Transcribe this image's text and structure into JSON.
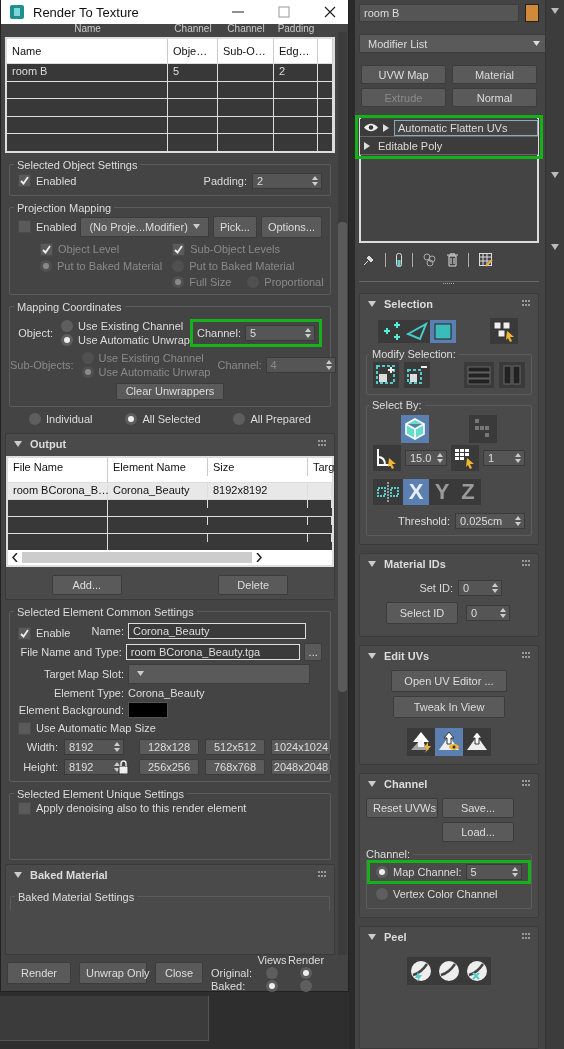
{
  "dialog": {
    "title": "Render To Texture",
    "objects": {
      "header_overflow": [
        "Name",
        "Channel",
        "Channel",
        "Padding"
      ],
      "columns": [
        "Name",
        "Obje…",
        "Sub-O…",
        "Edg…"
      ],
      "rows": [
        {
          "column_1": "room B",
          "column_2": "5",
          "column_4": "2"
        }
      ]
    },
    "selected_object_settings": {
      "title": "Selected Object Settings",
      "enabled": {
        "label": "Enabled",
        "checked": true
      },
      "padding": {
        "label": "Padding:",
        "value": "2"
      }
    },
    "projection_mapping": {
      "title": "Projection Mapping",
      "enabled": {
        "label": "Enabled",
        "checked": false
      },
      "modifier": "(No Proje...Modifier)",
      "buttons": [
        "Pick...",
        "Options..."
      ],
      "object_level": {
        "checkbox": {
          "label": "Object Level",
          "checked": true,
          "disabled": true
        },
        "radio": {
          "label": "Put to Baked Material",
          "selected": true,
          "disabled": true
        }
      },
      "sub_object_levels": {
        "checkbox": {
          "label": "Sub-Object Levels",
          "checked": true,
          "disabled": true
        },
        "radio": {
          "label": "Put to Baked Material",
          "selected": false,
          "disabled": true
        },
        "size_options": [
          {
            "label": "Full Size",
            "selected": true,
            "disabled": true
          },
          {
            "label": "Proportional",
            "selected": false,
            "disabled": true
          }
        ]
      }
    },
    "mapping_coordinates": {
      "title": "Mapping Coordinates",
      "object": {
        "label": "Object:",
        "disabled": false,
        "options": [
          {
            "label": "Use Existing Channel",
            "selected": false
          },
          {
            "label": "Use Automatic Unwrap",
            "selected": true
          }
        ],
        "channel": {
          "label": "Channel:",
          "value": "5",
          "highlighted": true
        }
      },
      "sub_objects": {
        "label": "Sub-Objects:",
        "disabled": true,
        "options": [
          {
            "label": "Use Existing Channel",
            "selected": false
          },
          {
            "label": "Use Automatic Unwrap",
            "selected": true
          }
        ],
        "channel": {
          "label": "Channel:",
          "value": "4",
          "highlighted": false
        }
      },
      "clear_button": "Clear Unwrappers"
    },
    "scope": [
      {
        "label": "Individual",
        "selected": false
      },
      {
        "label": "All Selected",
        "selected": true
      },
      {
        "label": "All Prepared",
        "selected": false
      }
    ],
    "output": {
      "title": "Output",
      "expanded": true,
      "columns": [
        "File Name",
        "Element Name",
        "Size",
        "Targ"
      ],
      "rows": [
        {
          "column_1": "room BCorona_B…",
          "column_2": "Corona_Beauty",
          "column_3": "8192x8192",
          "selected": true
        }
      ],
      "buttons": [
        "Add...",
        "Delete"
      ]
    },
    "element_common": {
      "title": "Selected Element Common Settings",
      "enable": {
        "label": "Enable",
        "checked": true
      },
      "name": {
        "label": "Name:",
        "value": "Corona_Beauty"
      },
      "file": {
        "label": "File Name and Type:",
        "value": "room BCorona_Beauty.tga",
        "browse": "..."
      },
      "target_slot": {
        "label": "Target Map Slot:"
      },
      "element_type": {
        "label": "Element Type:",
        "value": "Corona_Beauty"
      },
      "background": {
        "label": "Element Background:"
      },
      "auto_size": {
        "label": "Use Automatic Map Size",
        "checked": false
      },
      "width": {
        "label": "Width:",
        "value": "8192"
      },
      "height": {
        "label": "Height:",
        "value": "8192"
      },
      "presets": [
        "128x128",
        "512x512",
        "1024x1024",
        "256x256",
        "768x768",
        "2048x2048"
      ]
    },
    "element_unique": {
      "title": "Selected Element Unique Settings",
      "denoise": {
        "label": "Apply denoising also to this render element",
        "checked": false
      }
    },
    "baked_material": {
      "title": "Baked Material",
      "expanded": true,
      "group": "Baked Material Settings"
    },
    "footer": {
      "buttons": [
        "Render",
        "Unwrap Only",
        "Close"
      ],
      "headers": [
        "Views",
        "Render"
      ],
      "rows": [
        {
          "label": "Original:",
          "views": false,
          "render": true
        },
        {
          "label": "Baked:",
          "views": true,
          "render": false
        }
      ]
    }
  },
  "modify_panel": {
    "object_name": "room B",
    "modifier_list": "Modifier List",
    "buttons": [
      {
        "label": "UVW Map",
        "disabled": false
      },
      {
        "label": "Material",
        "disabled": false
      },
      {
        "label": "Extrude",
        "disabled": true
      },
      {
        "label": "Normal",
        "disabled": false
      }
    ],
    "stack": {
      "highlighted": true,
      "items": [
        {
          "label": "Automatic Flatten UVs",
          "selected": true,
          "visible": true
        },
        {
          "label": "Editable Poly",
          "selected": false,
          "visible": false
        }
      ]
    },
    "selection": {
      "title": "Selection",
      "expanded": true,
      "subobject": [
        {
          "kind": "vertex",
          "selected": false
        },
        {
          "kind": "edge",
          "selected": false
        },
        {
          "kind": "face",
          "selected": true
        }
      ],
      "modify_title": "Modify Selection:",
      "select_by_title": "Select By:",
      "select_by": [
        {
          "kind": "element",
          "selected": true
        },
        {
          "kind": "links",
          "selected": false
        }
      ],
      "angle": "15.0",
      "grid": "1",
      "axes": [
        {
          "label": "X",
          "selected": true
        },
        {
          "label": "Y",
          "selected": false
        },
        {
          "label": "Z",
          "selected": false
        }
      ],
      "threshold": {
        "label": "Threshold:",
        "value": "0.025cm"
      }
    },
    "material_ids": {
      "title": "Material IDs",
      "expanded": true,
      "set_id": {
        "label": "Set ID:",
        "value": "0"
      },
      "select_id": {
        "button": "Select ID",
        "value": "0"
      }
    },
    "edit_uvs": {
      "title": "Edit UVs",
      "expanded": true,
      "buttons": [
        "Open UV Editor ...",
        "Tweak In View"
      ],
      "tools": [
        {
          "selected": false
        },
        {
          "selected": true
        },
        {
          "selected": false
        }
      ]
    },
    "channel": {
      "title": "Channel",
      "expanded": true,
      "buttons": [
        "Reset UVWs",
        "Save...",
        "Load..."
      ],
      "group": "Channel:",
      "options": [
        {
          "label": "Map Channel:",
          "selected": true,
          "value": "5",
          "highlighted": true
        },
        {
          "label": "Vertex Color Channel",
          "selected": false,
          "highlighted": false
        }
      ]
    },
    "peel": {
      "title": "Peel",
      "expanded": true
    }
  }
}
